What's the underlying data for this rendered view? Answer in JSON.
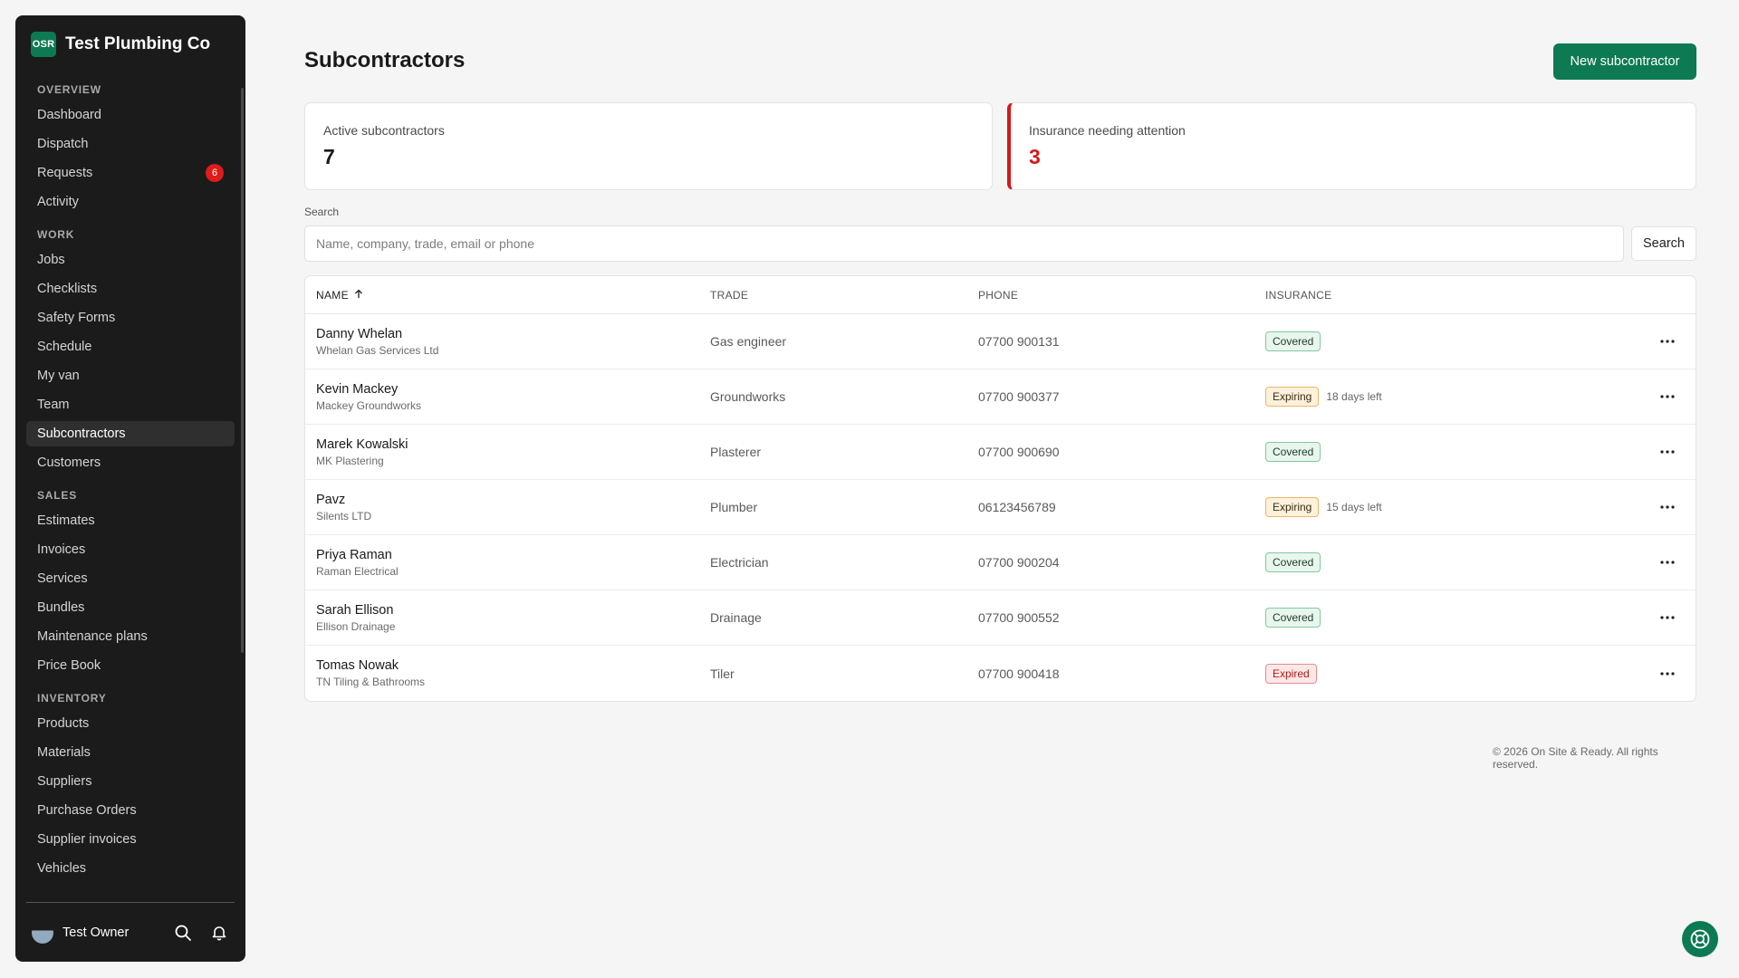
{
  "brand": {
    "logo_text": "OSR",
    "name": "Test Plumbing Co",
    "color": "#0d7a54"
  },
  "sidebar": {
    "sections": [
      {
        "label": "OVERVIEW",
        "items": [
          {
            "label": "Dashboard"
          },
          {
            "label": "Dispatch"
          },
          {
            "label": "Requests",
            "badge": "6"
          },
          {
            "label": "Activity"
          }
        ]
      },
      {
        "label": "WORK",
        "items": [
          {
            "label": "Jobs"
          },
          {
            "label": "Checklists"
          },
          {
            "label": "Safety Forms"
          },
          {
            "label": "Schedule"
          },
          {
            "label": "My van"
          },
          {
            "label": "Team"
          },
          {
            "label": "Subcontractors",
            "active": true
          },
          {
            "label": "Customers"
          }
        ]
      },
      {
        "label": "SALES",
        "items": [
          {
            "label": "Estimates"
          },
          {
            "label": "Invoices"
          },
          {
            "label": "Services"
          },
          {
            "label": "Bundles"
          },
          {
            "label": "Maintenance plans"
          },
          {
            "label": "Price Book"
          }
        ]
      },
      {
        "label": "INVENTORY",
        "items": [
          {
            "label": "Products"
          },
          {
            "label": "Materials"
          },
          {
            "label": "Suppliers"
          },
          {
            "label": "Purchase Orders"
          },
          {
            "label": "Supplier invoices"
          },
          {
            "label": "Vehicles"
          }
        ]
      }
    ],
    "footer": {
      "user_name": "Test Owner",
      "icons": [
        "search-icon",
        "bell-icon"
      ]
    }
  },
  "page": {
    "title": "Subcontractors",
    "new_button": "New subcontractor",
    "stats": {
      "active_label": "Active subcontractors",
      "active_value": "7",
      "insurance_label": "Insurance needing attention",
      "insurance_value": "3"
    },
    "search": {
      "label": "Search",
      "placeholder": "Name, company, trade, email or phone",
      "button": "Search"
    },
    "table": {
      "columns": {
        "name": "NAME",
        "trade": "TRADE",
        "phone": "PHONE",
        "insurance": "INSURANCE"
      },
      "sort": "ascending by name",
      "rows": [
        {
          "name": "Danny Whelan",
          "company": "Whelan Gas Services Ltd",
          "trade": "Gas engineer",
          "phone": "07700 900131",
          "insurance": "Covered",
          "status": "covered",
          "days_left": ""
        },
        {
          "name": "Kevin Mackey",
          "company": "Mackey Groundworks",
          "trade": "Groundworks",
          "phone": "07700 900377",
          "insurance": "Expiring",
          "status": "expiring",
          "days_left": "18 days left"
        },
        {
          "name": "Marek Kowalski",
          "company": "MK Plastering",
          "trade": "Plasterer",
          "phone": "07700 900690",
          "insurance": "Covered",
          "status": "covered",
          "days_left": ""
        },
        {
          "name": "Pavz",
          "company": "Silents LTD",
          "trade": "Plumber",
          "phone": "06123456789",
          "insurance": "Expiring",
          "status": "expiring",
          "days_left": "15 days left"
        },
        {
          "name": "Priya Raman",
          "company": "Raman Electrical",
          "trade": "Electrician",
          "phone": "07700 900204",
          "insurance": "Covered",
          "status": "covered",
          "days_left": ""
        },
        {
          "name": "Sarah Ellison",
          "company": "Ellison Drainage",
          "trade": "Drainage",
          "phone": "07700 900552",
          "insurance": "Covered",
          "status": "covered",
          "days_left": ""
        },
        {
          "name": "Tomas Nowak",
          "company": "TN Tiling & Bathrooms",
          "trade": "Tiler",
          "phone": "07700 900418",
          "insurance": "Expired",
          "status": "expired",
          "days_left": ""
        }
      ]
    },
    "copyright": "© 2026 On Site & Ready. All rights reserved."
  },
  "colors": {
    "accent": "#0d7a54",
    "alert": "#d41a1a",
    "sidebar_bg": "#1b1b1b",
    "page_bg": "#f5f5f5"
  }
}
